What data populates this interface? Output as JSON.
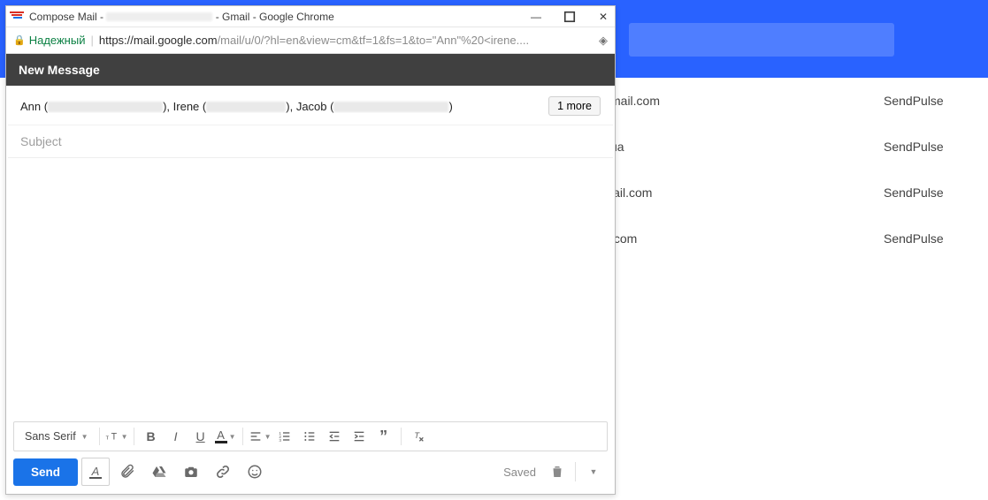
{
  "window": {
    "title_prefix": "Compose Mail -",
    "title_suffix": "- Gmail - Google Chrome"
  },
  "urlbar": {
    "secure_label": "Надежный",
    "domain": "https://mail.google.com",
    "path": "/mail/u/0/?hl=en&view=cm&tf=1&fs=1&to=\"Ann\"%20<irene...."
  },
  "compose": {
    "header": "New Message",
    "recipients": {
      "r1_name": "Ann",
      "r2_name": "Irene",
      "r3_name": "Jacob",
      "more_label": "1 more"
    },
    "subject_placeholder": "Subject",
    "subject_value": ""
  },
  "format_toolbar": {
    "font_label": "Sans Serif"
  },
  "bottom": {
    "send_label": "Send",
    "saved_label": "Saved"
  },
  "background_rows": [
    {
      "domain": "mail.com",
      "provider": "SendPulse"
    },
    {
      "domain": "ua",
      "provider": "SendPulse"
    },
    {
      "domain": "iail.com",
      "provider": "SendPulse"
    },
    {
      "domain": ".com",
      "provider": "SendPulse"
    }
  ],
  "icons": {
    "minimize": "—",
    "close": "✕"
  }
}
